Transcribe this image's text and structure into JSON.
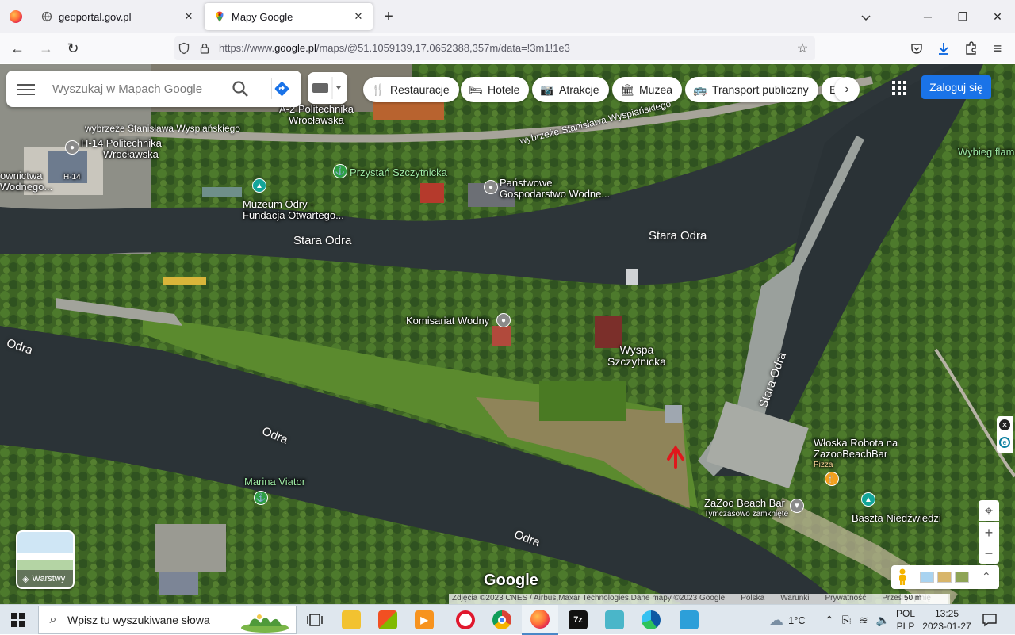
{
  "browser": {
    "tabs": [
      {
        "title": "geoportal.gov.pl",
        "active": false
      },
      {
        "title": "Mapy Google",
        "active": true
      }
    ],
    "url": {
      "prefix": "https://www.",
      "host": "google.pl",
      "rest": "/maps/@51.1059139,17.0652388,357m/data=!3m1!1e3"
    }
  },
  "maps": {
    "search": {
      "placeholder": "Wyszukaj w Mapach Google"
    },
    "chips": [
      "Restauracje",
      "Hotele",
      "Atrakcje",
      "Muzea",
      "Transport publiczny",
      "E"
    ],
    "signin_label": "Zaloguj się",
    "layers_label": "Warstwy",
    "google_logo": "Google",
    "attribution": [
      "Zdjęcia ©2023 CNES / Airbus,Maxar Technologies,Dane mapy ©2023 Google",
      "Polska",
      "Warunki",
      "Prywatność",
      "Prześlij opinię"
    ],
    "scale": "50 m",
    "labels": {
      "politechnika_a2_1": "A-2 Politechnika",
      "politechnika_a2_2": "Wrocławska",
      "h14_1": "H-14 Politechnika",
      "h14_2": "Wrocławska",
      "h14_small": "H-14",
      "przystan": "Przystań Szczytnicka",
      "panstwowe_1": "Państwowe",
      "panstwowe_2": "Gospodarstwo Wodne...",
      "muzeum_1": "Muzeum Odry -",
      "muzeum_2": "Fundacja Otwartego...",
      "wodnego_1": "ownictwa",
      "wodnego_2": "Wodnego...",
      "komisariat": "Komisariat Wodny",
      "wyspa_1": "Wyspa",
      "wyspa_2": "Szczytnicka",
      "marina": "Marina Viator",
      "wloska_1": "Włoska Robota na",
      "wloska_2": "ZazooBeachBar",
      "wloska_3": "Pizza",
      "zazoo": "ZaZoo Beach Bar",
      "zazoo_sub": "Tymczasowo zamknięte",
      "baszta": "Baszta Niedźwiedzi",
      "wybieg": "Wybieg flam",
      "street1": "wybrzeże Stanisława Wyspiańskiego",
      "street2": "wybrzeże Stanisława Wyspiańskiego",
      "stara_odra_1": "Stara Odra",
      "stara_odra_2": "Stara Odra",
      "stara_odra_3": "Stara Odra",
      "odra_1": "Odra",
      "odra_2": "Odra",
      "odra_3": "Odra"
    }
  },
  "taskbar": {
    "search_placeholder": "Wpisz tu wyszukiwane słowa",
    "weather": "1°C",
    "lang_1": "POL",
    "lang_2": "PLP",
    "time": "13:25",
    "date": "2023-01-27"
  },
  "colors": {
    "accent": "#1a73e8",
    "river": "#2a3236",
    "grass": "#4f7a2a",
    "arrow": "#e0181c"
  }
}
